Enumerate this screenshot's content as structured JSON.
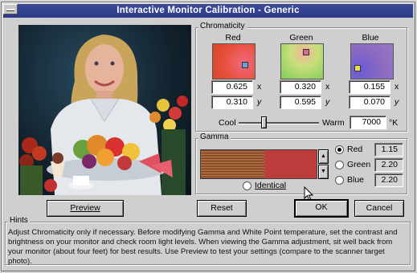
{
  "window": {
    "title": "Interactive Monitor Calibration - Generic"
  },
  "chromaticity": {
    "group_label": "Chromaticity",
    "columns": [
      {
        "label": "Red",
        "x_value": "0.625",
        "y_value": "0.310",
        "swatch_color": "#e85a50",
        "marker_color": "#6aa0d8"
      },
      {
        "label": "Green",
        "x_value": "0.320",
        "y_value": "0.595",
        "swatch_color": "#8fd06a",
        "marker_color": "#d07090"
      },
      {
        "label": "Blue",
        "x_value": "0.155",
        "y_value": "0.070",
        "swatch_color": "#8a70c8",
        "marker_color": "#e8e040"
      }
    ],
    "x_label": "x",
    "y_label": "y",
    "cool_label": "Cool",
    "warm_label": "Warm",
    "temperature_value": "7000",
    "temperature_unit": "°K",
    "slider_level": 0.3
  },
  "gamma": {
    "group_label": "Gamma",
    "identical_label": "Identical",
    "channels": [
      {
        "label": "Red",
        "value": "1.15",
        "selected": true
      },
      {
        "label": "Green",
        "value": "2.20",
        "selected": false
      },
      {
        "label": "Blue",
        "value": "2.20",
        "selected": false
      }
    ]
  },
  "buttons": {
    "preview": "Preview",
    "reset": "Reset",
    "ok": "OK",
    "cancel": "Cancel"
  },
  "hints": {
    "label": "Hints",
    "text": "Adjust Chromaticity only if necessary. Before modifying Gamma and White Point temperature, set the contrast and brightness on your monitor and check room light levels. When viewing the Gamma adjustment, sit well back from your monitor (about four feet) for best results. Use Preview to test your settings (compare to the scanner target photo)."
  },
  "colors": {
    "titlebar": "#2c3a86",
    "dialog_bg": "#cfcfcf"
  }
}
